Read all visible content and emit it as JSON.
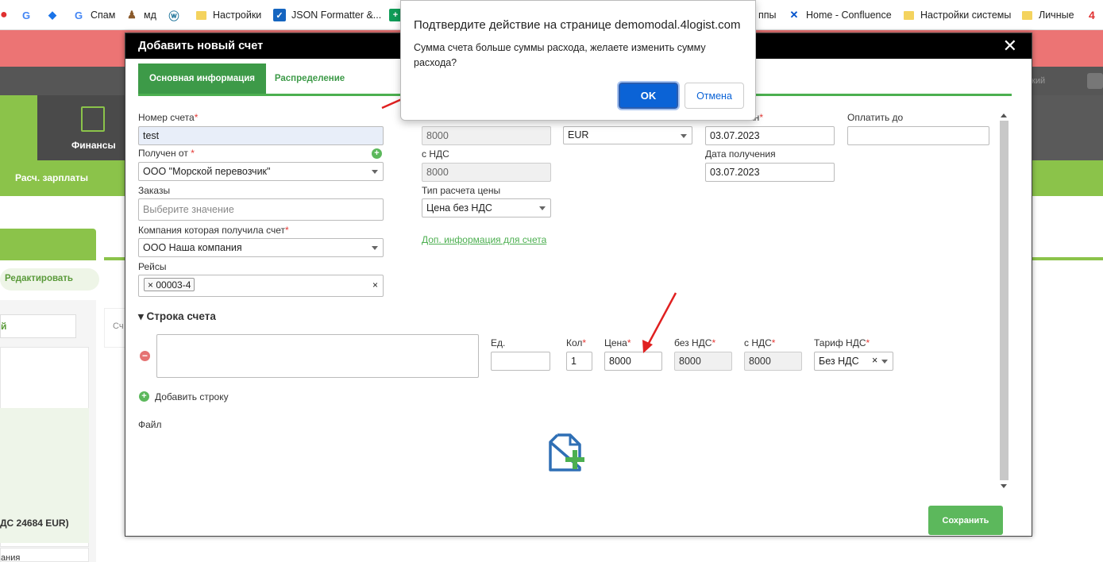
{
  "bookmarks": [
    {
      "label": "Спам",
      "icon": "google-icon"
    },
    {
      "label": "мд",
      "icon": "bookmark-icon"
    },
    {
      "label": "Настройки",
      "icon": "folder-icon"
    },
    {
      "label": "JSON Formatter &...",
      "icon": "checkbox-icon"
    },
    {
      "label": "ппы",
      "icon": "folder-icon"
    },
    {
      "label": "Home - Confluence",
      "icon": "confluence-icon"
    },
    {
      "label": "Настройки системы",
      "icon": "folder-icon"
    },
    {
      "label": "Личные",
      "icon": "folder-icon"
    }
  ],
  "background": {
    "nav_finance": "Финансы",
    "subnav_salary": "Расч. зарплаты",
    "edit_button": "Редактировать",
    "select_fragment": "й",
    "sum_fragment": "ДС 24684 EUR)",
    "bottom_fragment": "ания",
    "card_fragment": "Сч",
    "topright_fragment": "кий"
  },
  "modal": {
    "title": "Добавить новый счет",
    "tabs": [
      "Основная информация",
      "Распределение"
    ],
    "fields": {
      "invoice_number_label": "Номер счета",
      "invoice_number_value": "test",
      "received_from_label": "Получен от",
      "received_from_value": "ООО \"Морской перевозчик\"",
      "orders_label": "Заказы",
      "orders_placeholder": "Выберите значение",
      "company_label": "Компания которая получила счет",
      "company_value": "ООО Наша компания",
      "trips_label": "Рейсы",
      "trips_tag": "00003-4",
      "sum_value": "8000",
      "with_vat_label": "с НДС",
      "with_vat_value": "8000",
      "price_type_label": "Тип расчета цены",
      "price_type_value": "Цена без НДС",
      "extra_info_link": "Доп. информация для счета",
      "currency_value": "EUR",
      "issued_label": "ан",
      "issued_value": "03.07.2023",
      "received_date_label": "Дата получения",
      "received_date_value": "03.07.2023",
      "pay_until_label": "Оплатить до",
      "pay_until_value": ""
    },
    "line_section": {
      "title": "Строка счета",
      "unit_label": "Ед.",
      "qty_label": "Кол",
      "qty_value": "1",
      "price_label": "Цена",
      "price_value": "8000",
      "no_vat_label": "без НДС",
      "no_vat_value": "8000",
      "with_vat_label": "с НДС",
      "with_vat_value": "8000",
      "vat_rate_label": "Тариф НДС",
      "vat_rate_value": "Без НДС",
      "add_line": "Добавить строку"
    },
    "file_label": "Файл",
    "save_button": "Сохранить"
  },
  "alert": {
    "title": "Подтвердите действие на странице demomodal.4logist.com",
    "message": "Сумма счета больше суммы расхода, желаете изменить сумму расхода?",
    "ok": "OK",
    "cancel": "Отмена"
  },
  "colors": {
    "accent_green": "#4caf50",
    "alert_blue": "#0b63d6",
    "annotation_red": "#e02020"
  }
}
